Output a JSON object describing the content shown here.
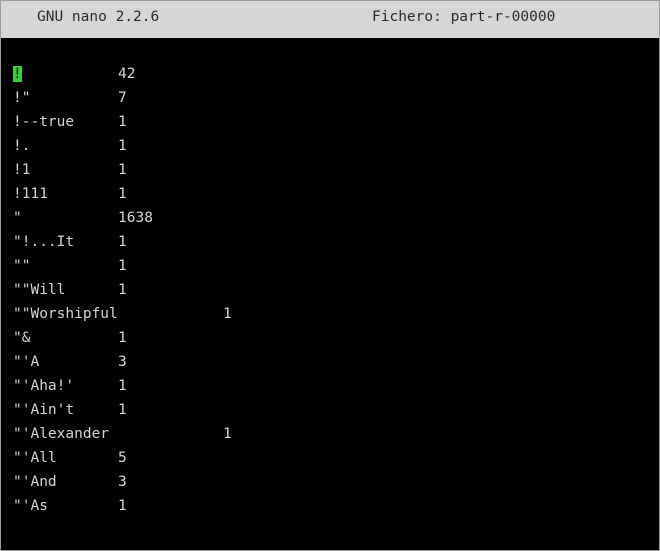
{
  "window": {
    "app_version_label": "GNU nano 2.2.6",
    "file_label": "Fichero: part-r-00000",
    "cursor_color": "#32d332"
  },
  "lines": [
    {
      "word": "!",
      "count": "42",
      "cursor": true
    },
    {
      "word": "!\"",
      "count": "7"
    },
    {
      "word": "!--true",
      "count": "1"
    },
    {
      "word": "!.",
      "count": "1"
    },
    {
      "word": "!1",
      "count": "1"
    },
    {
      "word": "!111",
      "count": "1"
    },
    {
      "word": "\"",
      "count": "1638"
    },
    {
      "word": "\"!...It",
      "count": "1"
    },
    {
      "word": "\"\"",
      "count": "1"
    },
    {
      "word": "\"\"Will",
      "count": "1"
    },
    {
      "word": "\"\"Worshipful",
      "count": "1",
      "wide": true
    },
    {
      "word": "\"&",
      "count": "1"
    },
    {
      "word": "\"'A",
      "count": "3"
    },
    {
      "word": "\"'Aha!'",
      "count": "1"
    },
    {
      "word": "\"'Ain't",
      "count": "1"
    },
    {
      "word": "\"'Alexander",
      "count": "1",
      "wide": true
    },
    {
      "word": "\"'All",
      "count": "5"
    },
    {
      "word": "\"'And",
      "count": "3"
    },
    {
      "word": "\"'As",
      "count": "1"
    }
  ]
}
